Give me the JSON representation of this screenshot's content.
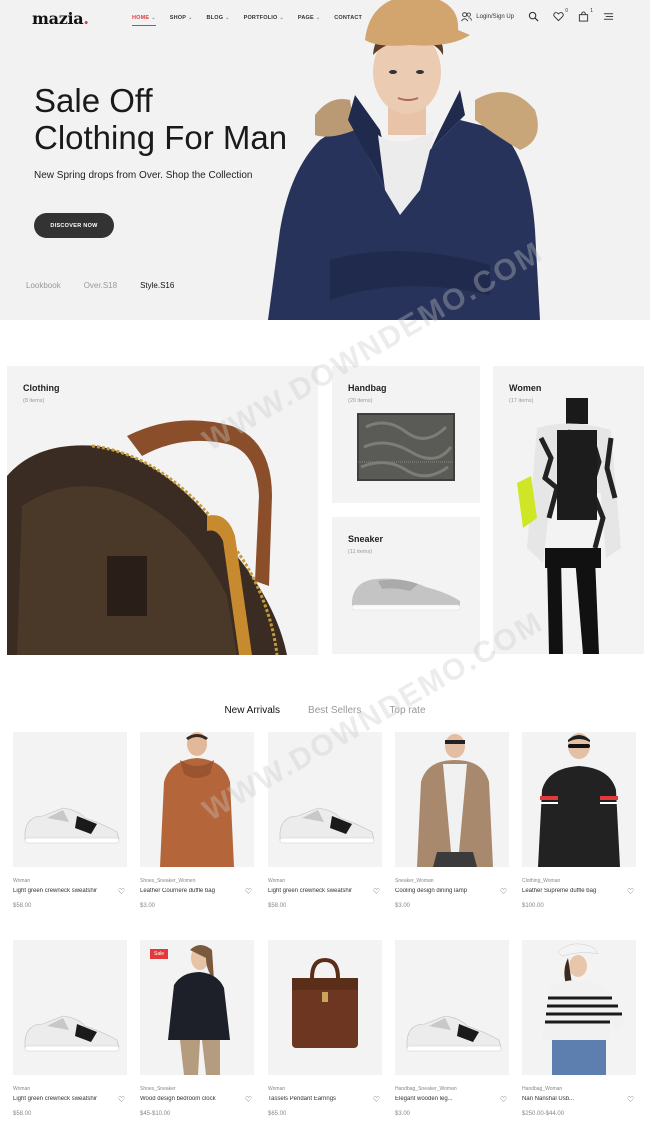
{
  "header": {
    "logo": "mazia",
    "nav": [
      {
        "label": "HOME",
        "caret": true
      },
      {
        "label": "SHOP",
        "caret": true
      },
      {
        "label": "BLOG",
        "caret": true
      },
      {
        "label": "PORTFOLIO",
        "caret": true
      },
      {
        "label": "PAGE",
        "caret": true
      },
      {
        "label": "CONTACT",
        "caret": false
      }
    ],
    "login_label": "Login/Sign Up",
    "wishlist_count": "0",
    "cart_count": "1"
  },
  "hero": {
    "title_line1": "Sale Off",
    "title_line2": "Clothing For Man",
    "subtitle": "New Spring drops from Over. Shop the Collection",
    "button": "DISCOVER NOW",
    "tabs": [
      "Lookbook",
      "Over.S18",
      "Style.S16"
    ],
    "active_tab": 2
  },
  "categories": [
    {
      "title": "Clothing",
      "count": "(8 items)"
    },
    {
      "title": "Handbag",
      "count": "(20 items)"
    },
    {
      "title": "Women",
      "count": "(17 items)"
    },
    {
      "title": "Sneaker",
      "count": "(11 items)"
    }
  ],
  "product_tabs": [
    "New Arrivals",
    "Best Sellers",
    "Top rate"
  ],
  "products": [
    {
      "category": "Woman",
      "name": "Light green crewneck sweatshir",
      "price": "$58.00"
    },
    {
      "category": "Shoes_Sneaker_Women",
      "name": "Leather Courriere duffle bag",
      "price": "$3.00"
    },
    {
      "category": "Woman",
      "name": "Light green crewneck sweatshir",
      "price": "$58.00"
    },
    {
      "category": "Sneaker_Woman",
      "name": "Cooling design dining lamp",
      "price": "$3.00"
    },
    {
      "category": "Clothing_Woman",
      "name": "Leather Supreme duffle bag",
      "price": "$100.00"
    },
    {
      "category": "Woman",
      "name": "Light green crewneck sweatshir",
      "price": "$58.00"
    },
    {
      "category": "Shoes_Sneaker",
      "name": "Wood design bedroom clock",
      "price": "$45-$10.00",
      "badge": "Sale"
    },
    {
      "category": "Woman",
      "name": "Tassels Pendant Earrings",
      "price": "$65.00"
    },
    {
      "category": "Handbag_Sneaker_Woman",
      "name": "Elegant wooden leg...",
      "price": "$3.00"
    },
    {
      "category": "Handbag_Woman",
      "name": "Nan Nanshal Usb...",
      "price": "$250.00-$44.00"
    }
  ],
  "colors": {
    "accent": "#e4393c",
    "dark": "#333333",
    "panel": "#f3f3f3",
    "navy": "#27335a"
  },
  "watermark": "WWW.DOWNDEMO.COM"
}
